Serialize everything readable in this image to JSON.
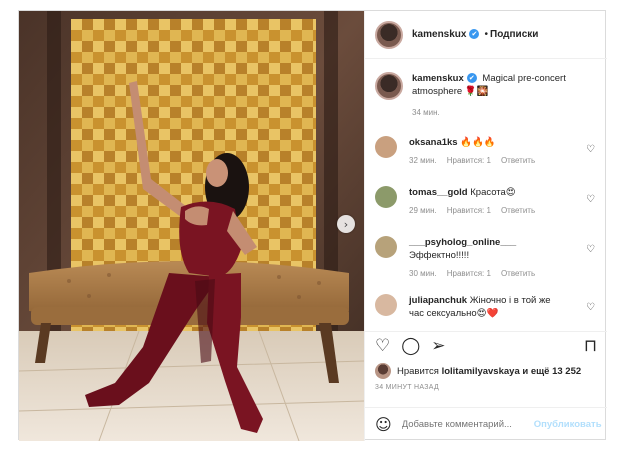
{
  "post": {
    "author": "kamenskux",
    "verified_mark": "✔",
    "follow_label": "Подписки",
    "caption_text": "Magical pre-concert atmosphere",
    "caption_emoji": "🌹🎇",
    "caption_time": "34 мин."
  },
  "comments": [
    {
      "user": "oksana1ks",
      "text": "🔥🔥🔥",
      "time": "32 мин.",
      "like_label": "Нравится: 1",
      "reply_label": "Ответить",
      "avatar_color": "#c9a07f"
    },
    {
      "user": "tomas__gold",
      "text": "Красота😍",
      "time": "29 мин.",
      "like_label": "Нравится: 1",
      "reply_label": "Ответить",
      "avatar_color": "#8c9a6a"
    },
    {
      "user": "___psyholog_online___",
      "text": "Эффектно!!!!!",
      "time": "30 мин.",
      "like_label": "Нравится: 1",
      "reply_label": "Ответить",
      "avatar_color": "#b7a27a"
    },
    {
      "user": "juliapanchuk",
      "text": "Жiночно i в той же час сексуально😍❤️",
      "time": "",
      "like_label": "",
      "reply_label": "",
      "avatar_color": "#d8b8a0"
    }
  ],
  "actions": {
    "like_icon": "heart-icon",
    "comment_icon": "comment-icon",
    "share_icon": "share-icon",
    "save_icon": "bookmark-icon"
  },
  "likes": {
    "prefix": "Нравится",
    "user": "lolitamilyavskaya",
    "suffix": "и ещё 13 252"
  },
  "posted_ago": "34 МИНУТ НАЗАД",
  "comment_box": {
    "placeholder": "Добавьте комментарий...",
    "publish_label": "Опубликовать"
  },
  "colors": {
    "accent": "#3897f0",
    "publish_disabled": "#b2dffc",
    "dress": "#7a1422",
    "wall_gold": "#d7a93e"
  }
}
